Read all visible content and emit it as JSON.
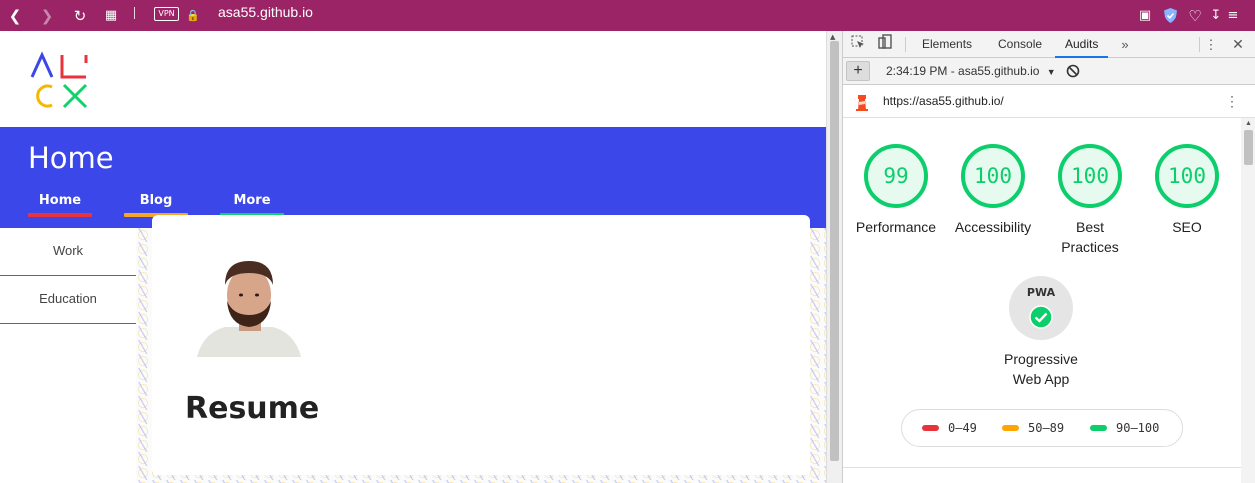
{
  "browser": {
    "url": "asa55.github.io",
    "vpn_label": "VPN",
    "icons": [
      "back-icon",
      "forward-icon",
      "reload-icon",
      "speed-dial-icon",
      "lock-icon",
      "camera-icon",
      "shield-icon",
      "heart-icon",
      "download-icon",
      "menu-icon"
    ]
  },
  "site": {
    "logo_colors": [
      "#3b47e8",
      "#e8323c",
      "#f5b800",
      "#10d26a"
    ],
    "hero_title": "Home",
    "hero_color": "#3b47e8",
    "nav": [
      {
        "label": "Home",
        "underline": "#e8323c"
      },
      {
        "label": "Blog",
        "underline": "#f5a623"
      },
      {
        "label": "More",
        "underline": "#10d26a"
      }
    ],
    "sidebar": [
      "Work",
      "Education"
    ],
    "section_title": "Resume"
  },
  "devtools": {
    "tabs": [
      "Elements",
      "Console",
      "Audits"
    ],
    "active_tab": "Audits",
    "more_tabs_icon": "»",
    "report_label": "2:34:19 PM - asa55.github.io",
    "audited_url": "https://asa55.github.io/",
    "gauges": [
      {
        "score": "99",
        "label": "Performance"
      },
      {
        "score": "100",
        "label": "Accessibility"
      },
      {
        "score": "100",
        "label": "Best Practices"
      },
      {
        "score": "100",
        "label": "SEO"
      }
    ],
    "pwa": {
      "badge_text": "PWA",
      "label": "Progressive Web App"
    },
    "legend": [
      {
        "range": "0–49",
        "color": "#e8323c"
      },
      {
        "range": "50–89",
        "color": "#ffa400"
      },
      {
        "range": "90–100",
        "color": "#0cce6b"
      }
    ]
  }
}
